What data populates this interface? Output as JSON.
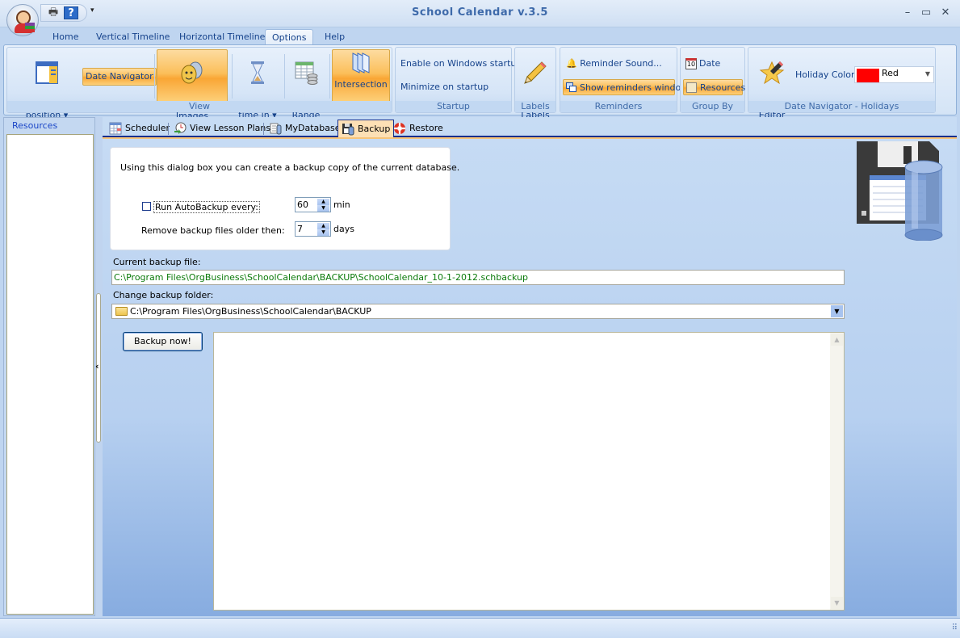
{
  "window": {
    "title": "School Calendar v.3.5",
    "minimize_icon": "minimize-icon",
    "maximize_icon": "maximize-icon",
    "close_icon": "close-icon"
  },
  "qat": {
    "print_icon": "printer-icon",
    "help_icon": "help-icon",
    "help_glyph": "?",
    "more_glyph": "▾"
  },
  "ribbon_tabs": [
    {
      "label": "Home"
    },
    {
      "label": "Vertical Timeline"
    },
    {
      "label": "Horizontal Timeline"
    },
    {
      "label": "Options",
      "active": true
    },
    {
      "label": "Help"
    }
  ],
  "ribbon": {
    "view": {
      "label": "View",
      "date_navigator_position": "Date Navigator\nposition ▾",
      "date_navigator": "Date Navigator",
      "show_resource_images": "Show Resource\nImages",
      "display_time_in": "Display\ntime in ▾",
      "work_range": "Work\nRange",
      "intersection": "Intersection"
    },
    "startup": {
      "label": "Startup",
      "enable_windows_startup": "Enable on Windows startup",
      "minimize_on_startup": "Minimize on startup"
    },
    "labels": {
      "label": "Labels",
      "status_labels": "Status\nLabels"
    },
    "reminders": {
      "label": "Reminders",
      "reminder_sound": "Reminder Sound...",
      "show_reminders_window": "Show reminders window"
    },
    "group_by": {
      "label": "Group By",
      "date": "Date",
      "resources": "Resources"
    },
    "holidays": {
      "label": "Date Navigator - Holidays",
      "holidays_editor": "Holidays\nEditor",
      "holiday_color_label": "Holiday Color",
      "holiday_color_value": "Red",
      "holiday_color_hex": "#ff0000"
    }
  },
  "left_panel": {
    "title": "Resources",
    "collapse_glyph": "‹"
  },
  "doc_tabs": [
    {
      "label": "Scheduler"
    },
    {
      "label": "View Lesson Plans"
    },
    {
      "label": "MyDatabase"
    },
    {
      "label": "Backup",
      "active": true
    },
    {
      "label": "Restore"
    }
  ],
  "backup": {
    "intro": "Using this dialog box you can create a backup copy of the current database.",
    "autobackup_label": "Run AutoBackup every:",
    "autobackup_checked": false,
    "autobackup_value": "60",
    "autobackup_unit": "min",
    "remove_label": "Remove backup files older then:",
    "remove_value": "7",
    "remove_unit": "days",
    "current_file_label": "Current backup file:",
    "current_file_value": "C:\\Program Files\\OrgBusiness\\SchoolCalendar\\BACKUP\\SchoolCalendar_10-1-2012.schbackup",
    "change_folder_label": "Change backup folder:",
    "folder_value": "C:\\Program Files\\OrgBusiness\\SchoolCalendar\\BACKUP",
    "backup_now": "Backup now!"
  }
}
